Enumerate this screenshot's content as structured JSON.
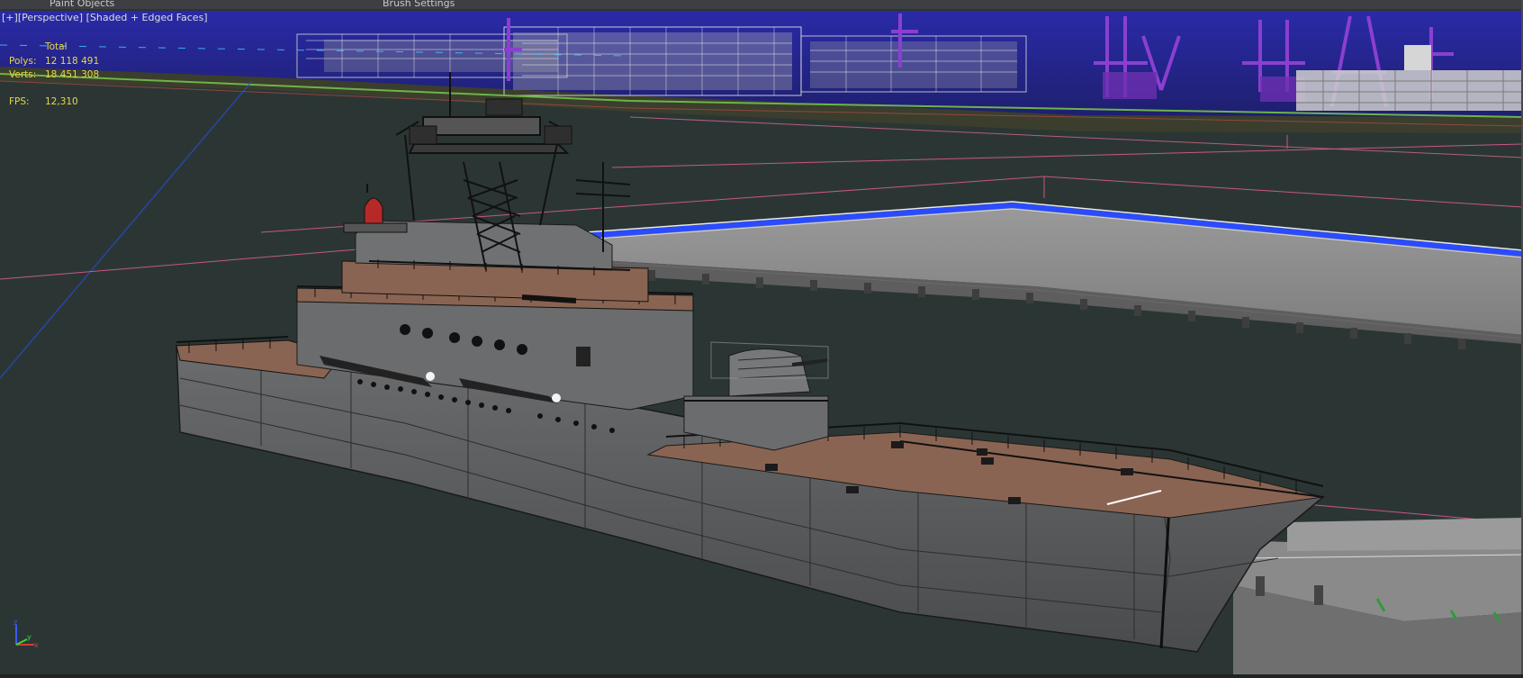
{
  "menubar": {
    "item1": "Paint Objects",
    "item2": "Brush Settings"
  },
  "viewport": {
    "menu_plus": "[+]",
    "menu_view": "[Perspective]",
    "menu_shading": "[Shaded + Edged Faces]"
  },
  "stats": {
    "header": "Total",
    "polys_label": "Polys:",
    "polys_value": "12 118 491",
    "verts_label": "Verts:",
    "verts_value": "18 451 308",
    "fps_label": "FPS:",
    "fps_value": "12,310"
  },
  "axis": {
    "x": "x",
    "y": "y",
    "z": "z"
  },
  "colors": {
    "background": "#2b3634",
    "stats_text": "#e6d84a",
    "selection_blue": "#2a4bff",
    "pier_grey": "#8d8d8d",
    "hull_grey": "#5c5d5f",
    "deck_brown": "#8a6452"
  },
  "icons": [
    "axis-tripod-icon"
  ]
}
